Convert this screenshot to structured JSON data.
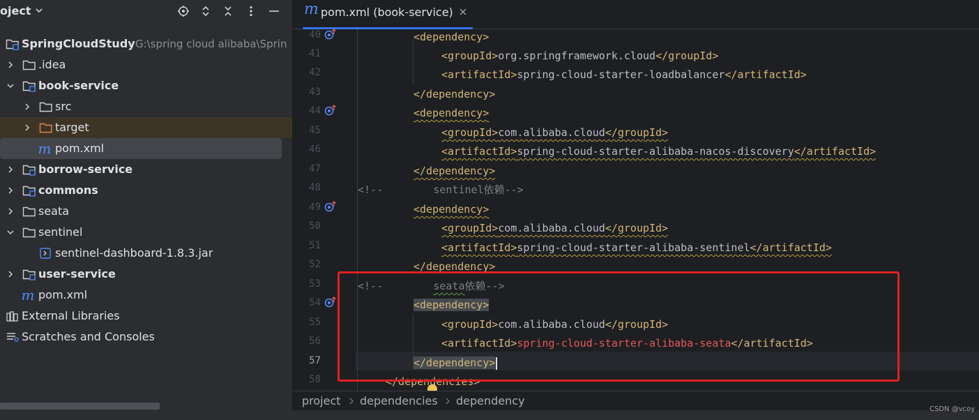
{
  "project_panel": {
    "title": "oject",
    "tree": [
      {
        "label": "SpringCloudStudy",
        "path": "G:\\spring cloud alibaba\\Sprin"
      },
      {
        "label": ".idea"
      },
      {
        "label": "book-service"
      },
      {
        "label": "src"
      },
      {
        "label": "target"
      },
      {
        "label": "pom.xml"
      },
      {
        "label": "borrow-service"
      },
      {
        "label": "commons"
      },
      {
        "label": "seata"
      },
      {
        "label": "sentinel"
      },
      {
        "label": "sentinel-dashboard-1.8.3.jar"
      },
      {
        "label": "user-service"
      },
      {
        "label": "pom.xml"
      },
      {
        "label": "External Libraries"
      },
      {
        "label": "Scratches and Consoles"
      }
    ]
  },
  "editor": {
    "tab": {
      "icon": "m",
      "label": "pom.xml (book-service)"
    },
    "line_numbers": [
      "40",
      "41",
      "42",
      "43",
      "44",
      "45",
      "46",
      "47",
      "48",
      "49",
      "50",
      "51",
      "52",
      "53",
      "54",
      "55",
      "56",
      "57",
      "58"
    ],
    "code": {
      "l40_tag": "<dependency>",
      "l41_open": "<groupId>",
      "l41_val": "org.springframework.cloud",
      "l41_close": "</groupId>",
      "l42_open": "<artifactId>",
      "l42_val": "spring-cloud-starter-loadbalancer",
      "l42_close": "</artifactId>",
      "l43_tag": "</dependency>",
      "l44_tag": "<dependency>",
      "l45_open": "<groupId>",
      "l45_val": "com.alibaba.cloud",
      "l45_close": "</groupId>",
      "l46_open": "<artifactId>",
      "l46_val": "spring-cloud-starter-alibaba-nacos-discovery",
      "l46_close": "</artifactId>",
      "l47_tag": "</dependency>",
      "l48_cmt_start": "<!--",
      "l48_cmt_text": "sentinel依赖",
      "l48_cmt_end": "-->",
      "l49_tag": "<dependency>",
      "l50_open": "<groupId>",
      "l50_val": "com.alibaba.cloud",
      "l50_close": "</groupId>",
      "l51_open": "<artifactId>",
      "l51_val": "spring-cloud-starter-alibaba-sentinel",
      "l51_close": "</artifactId>",
      "l52_tag": "</dependency>",
      "l53_cmt_start": "<!--",
      "l53_cmt_word": "seata",
      "l53_cmt_text": "依赖",
      "l53_cmt_end": "-->",
      "l54_tag": "<dependency>",
      "l55_open": "<groupId>",
      "l55_val": "com.alibaba.cloud",
      "l55_close": "</groupId>",
      "l56_open": "<artifactId>",
      "l56_val": "spring-cloud-starter-alibaba-seata",
      "l56_close": "</artifactId>",
      "l57_tag": "</dependency>",
      "l58_tag": "</dependencies>"
    }
  },
  "breadcrumbs": [
    "project",
    "dependencies",
    "dependency"
  ],
  "watermark": "CSDN @vcoy",
  "colors": {
    "accent": "#3574f0",
    "tag": "#d5b778",
    "highlight_box": "#e02020"
  }
}
